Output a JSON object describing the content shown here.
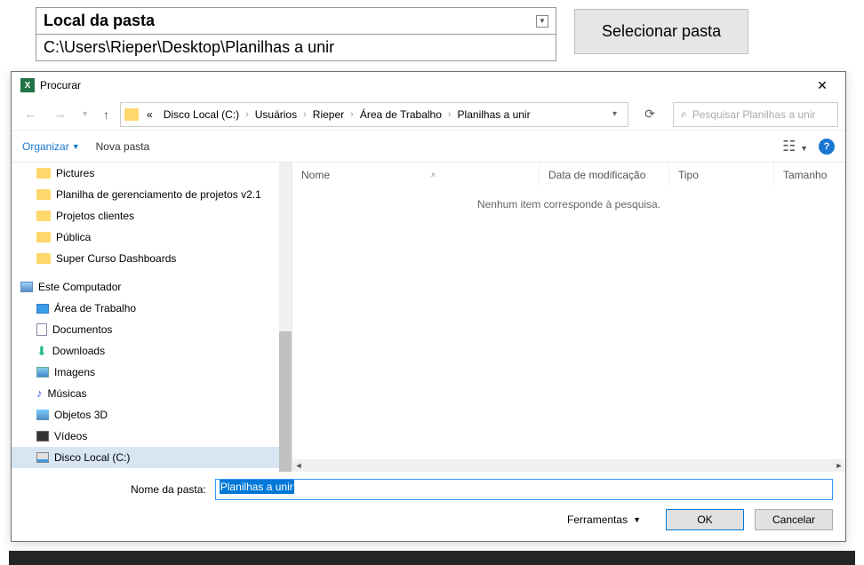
{
  "sheet": {
    "header_label": "Local da pasta",
    "path_value": "C:\\Users\\Rieper\\Desktop\\Planilhas a unir",
    "select_button": "Selecionar pasta"
  },
  "dialog": {
    "title": "Procurar",
    "breadcrumb_prefix": "«",
    "breadcrumb": [
      "Disco Local (C:)",
      "Usuários",
      "Rieper",
      "Área de Trabalho",
      "Planilhas a unir"
    ],
    "search_placeholder": "Pesquisar Planilhas a unir",
    "toolbar": {
      "organize": "Organizar",
      "new_folder": "Nova pasta"
    },
    "tree": {
      "folders": [
        "Pictures",
        "Planilha de gerenciamento de projetos v2.1",
        "Projetos clientes",
        "Pública",
        "Super Curso Dashboards"
      ],
      "this_pc": "Este Computador",
      "pc_items": [
        {
          "label": "Área de Trabalho",
          "icon": "desk"
        },
        {
          "label": "Documentos",
          "icon": "doc"
        },
        {
          "label": "Downloads",
          "icon": "dl"
        },
        {
          "label": "Imagens",
          "icon": "img"
        },
        {
          "label": "Músicas",
          "icon": "mus"
        },
        {
          "label": "Objetos 3D",
          "icon": "obj"
        },
        {
          "label": "Vídeos",
          "icon": "vid"
        },
        {
          "label": "Disco Local (C:)",
          "icon": "disk",
          "selected": true
        }
      ]
    },
    "columns": {
      "name": "Nome",
      "modified": "Data de modificação",
      "type": "Tipo",
      "size": "Tamanho"
    },
    "empty_message": "Nenhum item corresponde à pesquisa.",
    "folder_name_label": "Nome da pasta:",
    "folder_name_value": "Planilhas a unir",
    "tools_label": "Ferramentas",
    "ok_label": "OK",
    "cancel_label": "Cancelar"
  }
}
